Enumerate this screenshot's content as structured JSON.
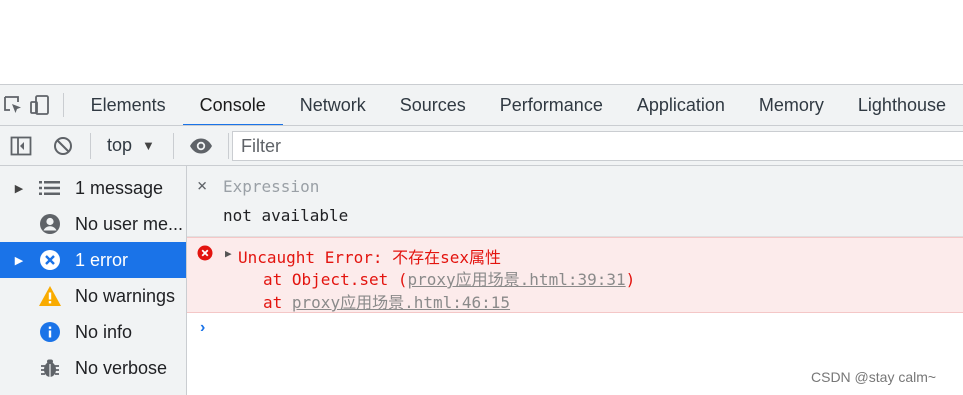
{
  "tabs": [
    "Elements",
    "Console",
    "Network",
    "Sources",
    "Performance",
    "Application",
    "Memory",
    "Lighthouse"
  ],
  "toolbar": {
    "context": "top",
    "filter_placeholder": "Filter"
  },
  "sidebar": [
    {
      "label": "1 message",
      "icon": "list-icon"
    },
    {
      "label": "No user me...",
      "icon": "user-icon"
    },
    {
      "label": "1 error",
      "icon": "error-icon"
    },
    {
      "label": "No warnings",
      "icon": "warning-icon"
    },
    {
      "label": "No info",
      "icon": "info-icon"
    },
    {
      "label": "No verbose",
      "icon": "bug-icon"
    }
  ],
  "expression": {
    "close": "×",
    "placeholder": "Expression",
    "value": "not available"
  },
  "error": {
    "message": "Uncaught Error: 不存在sex属性",
    "frame1_prefix": "at Object.set (",
    "frame1_link": "proxy应用场景.html:39:31",
    "frame1_suffix": ")",
    "frame2_prefix": "at ",
    "frame2_link": "proxy应用场景.html:46:15"
  },
  "prompt": "›",
  "watermark": "CSDN @stay calm~",
  "colors": {
    "accent": "#1a73e8",
    "error": "#e3140f",
    "error_bg": "#fcebeb",
    "warning": "#f9ab00"
  }
}
